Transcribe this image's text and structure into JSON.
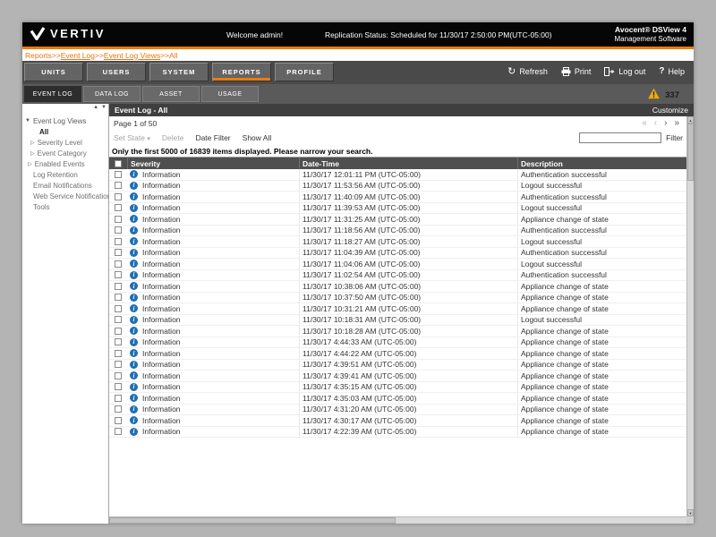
{
  "header": {
    "brand": "VERTIV",
    "welcome": "Welcome admin!",
    "replication_status": "Replication Status: Scheduled for 11/30/17 2:50:00 PM(UTC-05:00)",
    "product_name": "Avocent® DSView 4",
    "product_sub": "Management Software"
  },
  "breadcrumb": {
    "separator": ">>",
    "parts": [
      "Reports",
      "Event Log",
      "Event Log Views",
      "All"
    ]
  },
  "nav": {
    "tabs": [
      "UNITS",
      "USERS",
      "SYSTEM",
      "REPORTS",
      "PROFILE"
    ],
    "active_tab": "REPORTS",
    "actions": {
      "refresh": "Refresh",
      "print": "Print",
      "logout": "Log out",
      "help": "Help"
    }
  },
  "subnav": {
    "tabs": [
      "EVENT LOG",
      "DATA LOG",
      "ASSET",
      "USAGE"
    ],
    "active_tab": "EVENT LOG",
    "alert_count": "337"
  },
  "sidebar": {
    "group_label": "Event Log Views",
    "items": [
      {
        "label": "All",
        "selected": true
      },
      {
        "label": "Severity Level"
      },
      {
        "label": "Event Category"
      },
      {
        "label": "Enabled Events"
      },
      {
        "label": "Log Retention"
      },
      {
        "label": "Email Notifications"
      },
      {
        "label": "Web Service Notifications"
      },
      {
        "label": "Tools"
      }
    ]
  },
  "main": {
    "panel_title": "Event Log - All",
    "customize_label": "Customize",
    "page_label": "Page 1 of 50",
    "pagination": {
      "first": "«",
      "prev": "‹",
      "next": "›",
      "last": "»"
    },
    "toolbar": {
      "set_state": "Set State",
      "delete": "Delete",
      "date_filter": "Date Filter",
      "show_all": "Show All",
      "filter_button": "Filter",
      "filter_value": ""
    },
    "notice": "Only the first 5000 of 16839 items displayed. Please narrow your search.",
    "table": {
      "columns": [
        "Severity",
        "Date-Time",
        "Description"
      ],
      "rows": [
        {
          "severity": "Information",
          "datetime": "11/30/17 12:01:11 PM (UTC-05:00)",
          "description": "Authentication successful"
        },
        {
          "severity": "Information",
          "datetime": "11/30/17 11:53:56 AM (UTC-05:00)",
          "description": "Logout successful"
        },
        {
          "severity": "Information",
          "datetime": "11/30/17 11:40:09 AM (UTC-05:00)",
          "description": "Authentication successful"
        },
        {
          "severity": "Information",
          "datetime": "11/30/17 11:39:53 AM (UTC-05:00)",
          "description": "Logout successful"
        },
        {
          "severity": "Information",
          "datetime": "11/30/17 11:31:25 AM (UTC-05:00)",
          "description": "Appliance change of state"
        },
        {
          "severity": "Information",
          "datetime": "11/30/17 11:18:56 AM (UTC-05:00)",
          "description": "Authentication successful"
        },
        {
          "severity": "Information",
          "datetime": "11/30/17 11:18:27 AM (UTC-05:00)",
          "description": "Logout successful"
        },
        {
          "severity": "Information",
          "datetime": "11/30/17 11:04:39 AM (UTC-05:00)",
          "description": "Authentication successful"
        },
        {
          "severity": "Information",
          "datetime": "11/30/17 11:04:06 AM (UTC-05:00)",
          "description": "Logout successful"
        },
        {
          "severity": "Information",
          "datetime": "11/30/17 11:02:54 AM (UTC-05:00)",
          "description": "Authentication successful"
        },
        {
          "severity": "Information",
          "datetime": "11/30/17 10:38:06 AM (UTC-05:00)",
          "description": "Appliance change of state"
        },
        {
          "severity": "Information",
          "datetime": "11/30/17 10:37:50 AM (UTC-05:00)",
          "description": "Appliance change of state"
        },
        {
          "severity": "Information",
          "datetime": "11/30/17 10:31:21 AM (UTC-05:00)",
          "description": "Appliance change of state"
        },
        {
          "severity": "Information",
          "datetime": "11/30/17 10:18:31 AM (UTC-05:00)",
          "description": "Logout successful"
        },
        {
          "severity": "Information",
          "datetime": "11/30/17 10:18:28 AM (UTC-05:00)",
          "description": "Appliance change of state"
        },
        {
          "severity": "Information",
          "datetime": "11/30/17 4:44:33 AM (UTC-05:00)",
          "description": "Appliance change of state"
        },
        {
          "severity": "Information",
          "datetime": "11/30/17 4:44:22 AM (UTC-05:00)",
          "description": "Appliance change of state"
        },
        {
          "severity": "Information",
          "datetime": "11/30/17 4:39:51 AM (UTC-05:00)",
          "description": "Appliance change of state"
        },
        {
          "severity": "Information",
          "datetime": "11/30/17 4:39:41 AM (UTC-05:00)",
          "description": "Appliance change of state"
        },
        {
          "severity": "Information",
          "datetime": "11/30/17 4:35:15 AM (UTC-05:00)",
          "description": "Appliance change of state"
        },
        {
          "severity": "Information",
          "datetime": "11/30/17 4:35:03 AM (UTC-05:00)",
          "description": "Appliance change of state"
        },
        {
          "severity": "Information",
          "datetime": "11/30/17 4:31:20 AM (UTC-05:00)",
          "description": "Appliance change of state"
        },
        {
          "severity": "Information",
          "datetime": "11/30/17 4:30:17 AM (UTC-05:00)",
          "description": "Appliance change of state"
        },
        {
          "severity": "Information",
          "datetime": "11/30/17 4:22:39 AM (UTC-05:00)",
          "description": "Appliance change of state"
        }
      ]
    }
  },
  "icons": {
    "refresh": "↻",
    "help": "?",
    "info": "i",
    "caret_down": "▾",
    "tree_open": "▼",
    "tree_closed": "▷",
    "scroll_up": "▲",
    "scroll_down": "▼"
  },
  "colors": {
    "accent_orange": "#EE7B0C",
    "info_blue": "#1E6FB4",
    "warning_yellow": "#F2A81D"
  }
}
